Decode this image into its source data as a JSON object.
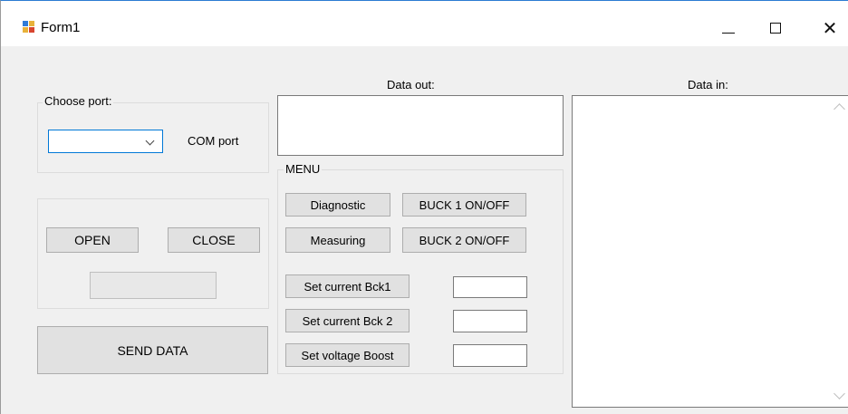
{
  "window": {
    "title": "Form1",
    "minimize": "—",
    "close": "✕"
  },
  "port_group": {
    "label": "Choose port:",
    "combo_value": "",
    "com_label": "COM port"
  },
  "connection": {
    "open_label": "OPEN",
    "close_label": "CLOSE",
    "status_value": ""
  },
  "send_label": "SEND DATA",
  "data_out": {
    "label": "Data out:",
    "value": ""
  },
  "menu": {
    "label": "MENU",
    "diagnostic": "Diagnostic",
    "buck1": "BUCK 1 ON/OFF",
    "measuring": "Measuring",
    "buck2": "BUCK 2 ON/OFF",
    "set_current_bck1": "Set current Bck1",
    "set_current_bck2": "Set current Bck 2",
    "set_voltage_boost": "Set voltage Boost",
    "bck1_value": "",
    "bck2_value": "",
    "boost_value": ""
  },
  "data_in": {
    "label": "Data in:",
    "value": ""
  }
}
